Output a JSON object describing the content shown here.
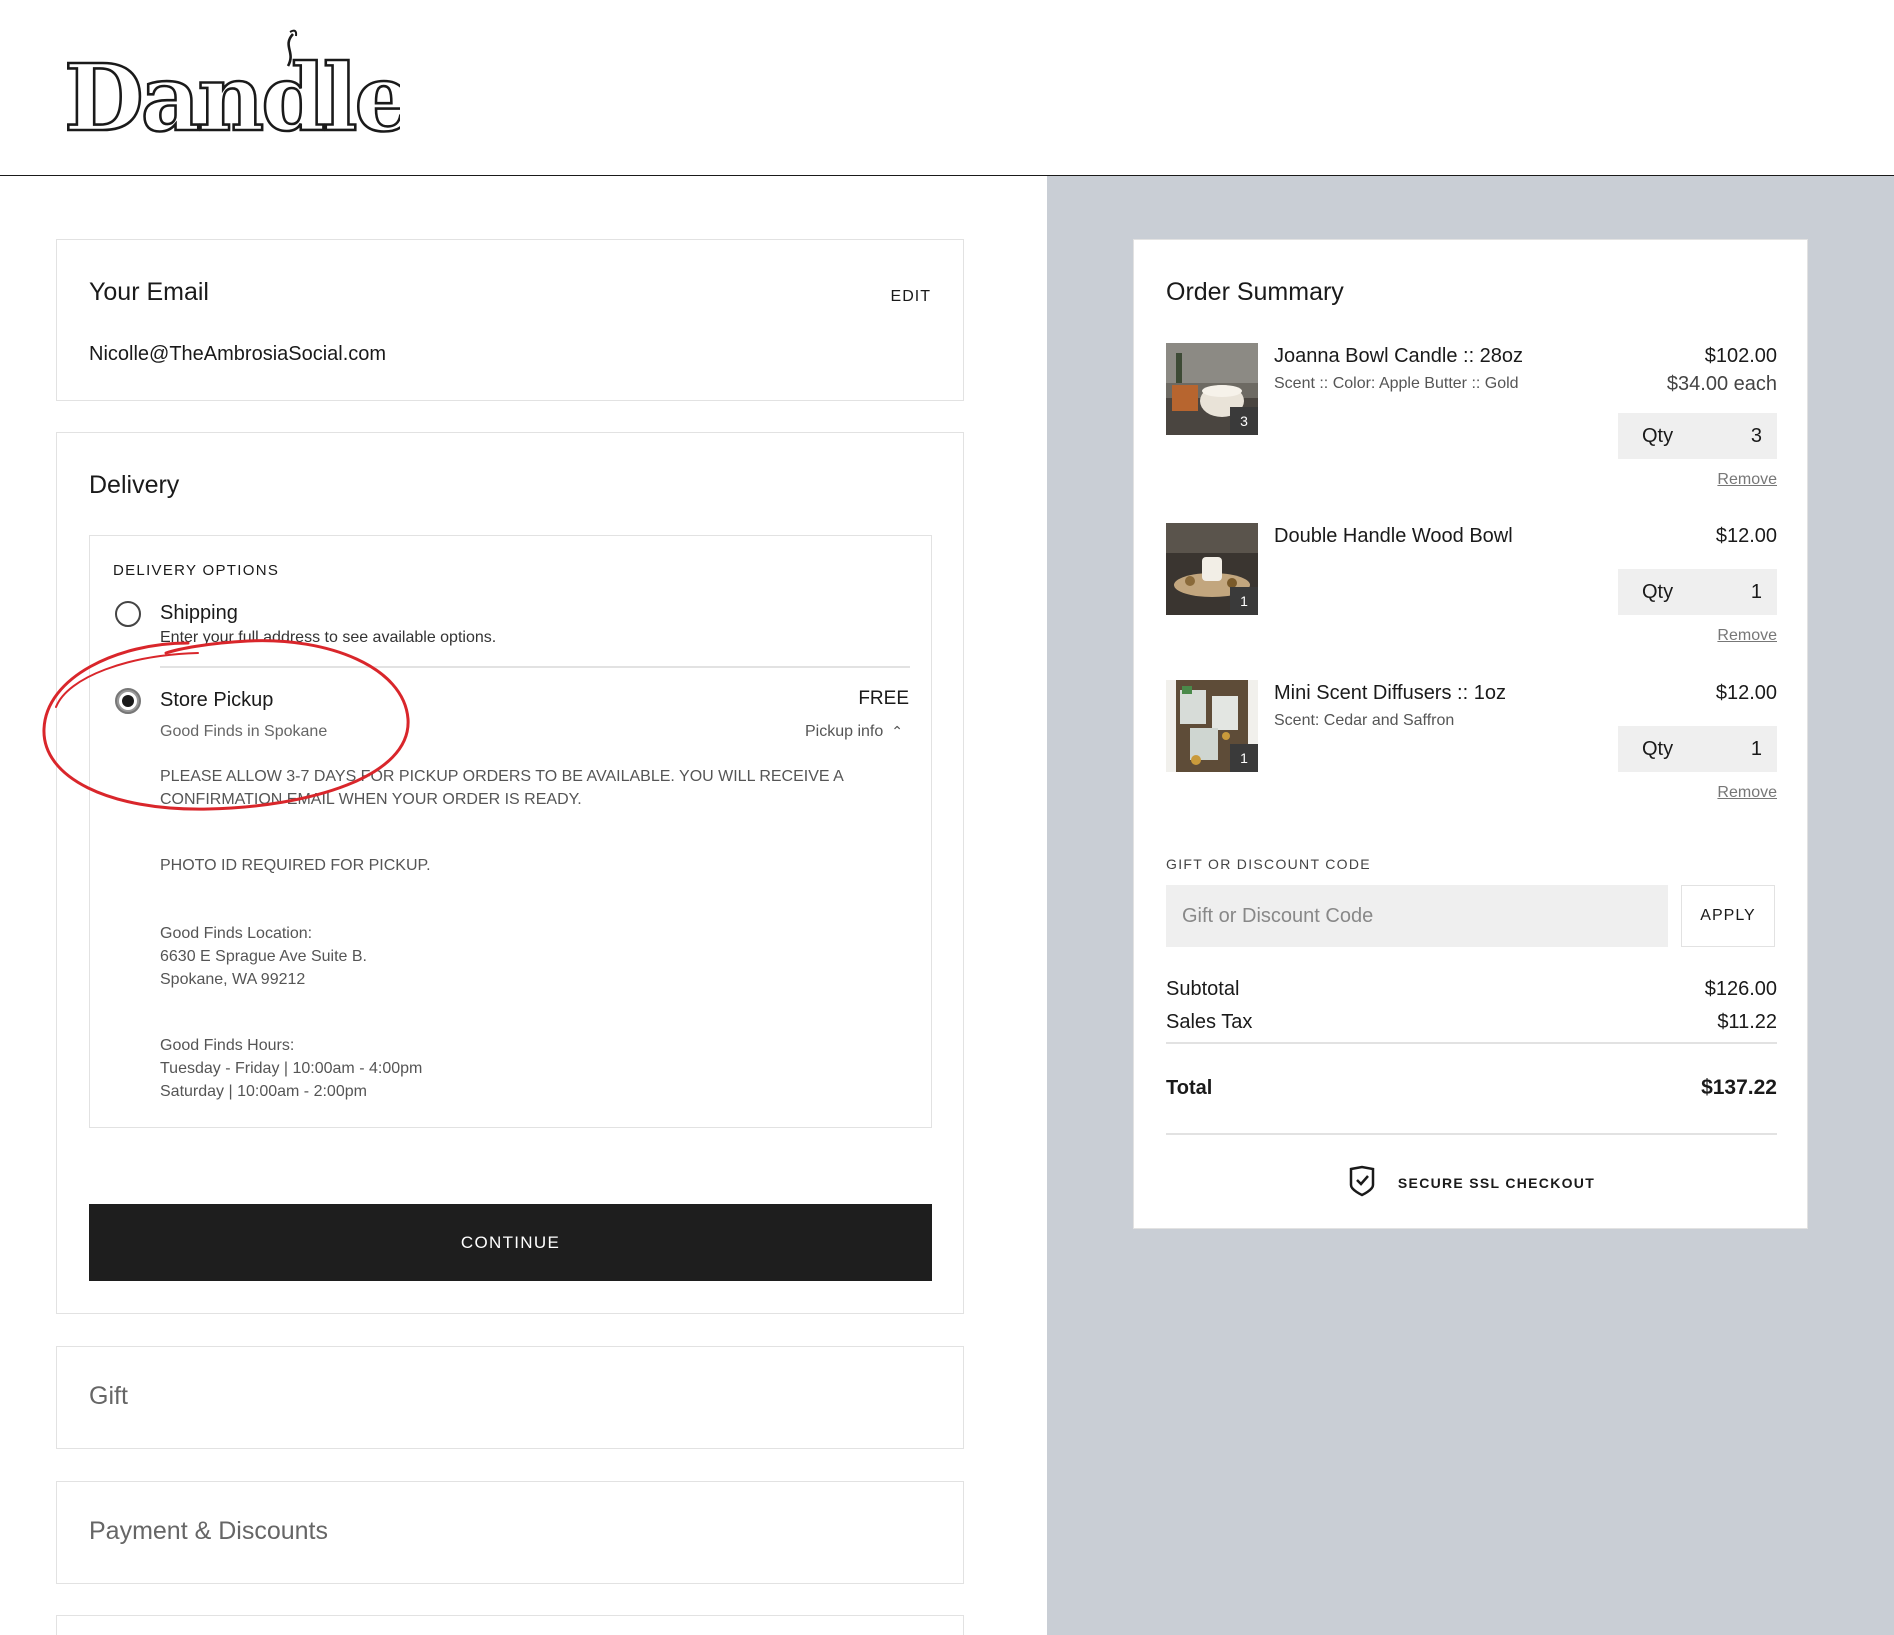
{
  "brand": {
    "logo_text": "Dandles"
  },
  "email": {
    "title": "Your Email",
    "edit_label": "EDIT",
    "value": "Nicolle@TheAmbrosiaSocial.com"
  },
  "delivery": {
    "title": "Delivery",
    "options_heading": "DELIVERY OPTIONS",
    "shipping": {
      "label": "Shipping",
      "note": "Enter your full address to see available options.",
      "selected": false
    },
    "pickup": {
      "label": "Store Pickup",
      "location_name": "Good Finds in Spokane",
      "price": "FREE",
      "info_label": "Pickup info",
      "selected": true,
      "notice": "PLEASE ALLOW 3-7 DAYS FOR PICKUP ORDERS TO BE AVAILABLE. YOU WILL RECEIVE A CONFIRMATION EMAIL WHEN YOUR ORDER IS READY.",
      "id_notice": "PHOTO ID REQUIRED FOR PICKUP.",
      "location_title": "Good Finds Location:",
      "address_line1": "6630 E Sprague Ave Suite B.",
      "address_line2": "Spokane, WA 99212",
      "hours_title": "Good Finds Hours:",
      "hours_line1": "Tuesday - Friday | 10:00am - 4:00pm",
      "hours_line2": "Saturday | 10:00am - 2:00pm"
    },
    "continue_label": "CONTINUE"
  },
  "gift": {
    "title": "Gift"
  },
  "payment": {
    "title": "Payment & Discounts"
  },
  "summary": {
    "title": "Order Summary",
    "items": [
      {
        "name": "Joanna Bowl Candle :: 28oz",
        "variant": "Scent :: Color: Apple Butter :: Gold",
        "price": "$102.00",
        "each": "$34.00 each",
        "qty_label": "Qty",
        "qty": "3",
        "badge": "3",
        "remove_label": "Remove"
      },
      {
        "name": "Double Handle Wood Bowl",
        "variant": "",
        "price": "$12.00",
        "each": "",
        "qty_label": "Qty",
        "qty": "1",
        "badge": "1",
        "remove_label": "Remove"
      },
      {
        "name": "Mini Scent Diffusers :: 1oz",
        "variant": "Scent: Cedar and Saffron",
        "price": "$12.00",
        "each": "",
        "qty_label": "Qty",
        "qty": "1",
        "badge": "1",
        "remove_label": "Remove"
      }
    ],
    "code_label": "GIFT OR DISCOUNT CODE",
    "code_placeholder": "Gift or Discount Code",
    "apply_label": "APPLY",
    "subtotal_label": "Subtotal",
    "subtotal": "$126.00",
    "tax_label": "Sales Tax",
    "tax": "$11.22",
    "total_label": "Total",
    "total": "$137.22",
    "ssl_label": "SECURE SSL CHECKOUT"
  },
  "colors": {
    "panel_gray": "#c9ced5",
    "button_dark": "#1e1e1e",
    "annotation_red": "#d9262b"
  }
}
